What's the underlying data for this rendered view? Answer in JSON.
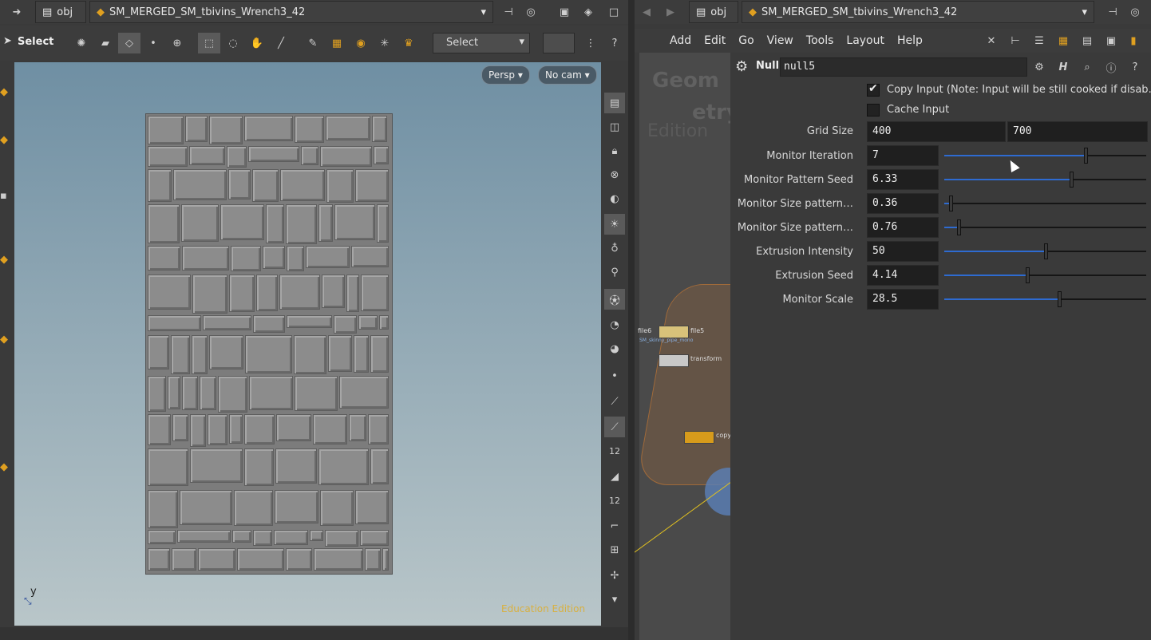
{
  "left_pane": {
    "path_root": "obj",
    "object_name": "SM_MERGED_SM_tbivins_Wrench3_42",
    "toolbar": {
      "tool_label": "Select",
      "selection_dropdown": "Select"
    },
    "viewport": {
      "persp_button": "Persp",
      "cam_button": "No cam",
      "axis_label": "y",
      "watermark": "Education Edition"
    }
  },
  "right_pane": {
    "path_root": "obj",
    "object_name": "SM_MERGED_SM_tbivins_Wrench3_42",
    "menu": [
      "Add",
      "Edit",
      "Go",
      "View",
      "Tools",
      "Layout",
      "Help"
    ],
    "network_watermark": [
      "Geom",
      "etry",
      "Edition"
    ],
    "nodes": [
      "file6",
      "file5",
      "transform",
      "copy"
    ],
    "node_subtext": "SM_skinny_pipe_mono"
  },
  "parameters": {
    "node_type": "Null",
    "node_name": "null5",
    "copy_input_label": "Copy Input (Note: Input will be still cooked if disab…",
    "copy_input_checked": true,
    "cache_input_label": "Cache Input",
    "cache_input_checked": false,
    "grid_size_label": "Grid Size",
    "grid_size": [
      "400",
      "700"
    ],
    "sliders": [
      {
        "label": "Monitor Iteration",
        "value": "7",
        "fraction": 0.7
      },
      {
        "label": "Monitor Pattern Seed",
        "value": "6.33",
        "fraction": 0.63
      },
      {
        "label": "Monitor Size pattern…",
        "value": "0.36",
        "fraction": 0.03
      },
      {
        "label": "Monitor Size pattern…",
        "value": "0.76",
        "fraction": 0.07
      },
      {
        "label": "Extrusion Intensity",
        "value": "50",
        "fraction": 0.5
      },
      {
        "label": "Extrusion Seed",
        "value": "4.14",
        "fraction": 0.41
      },
      {
        "label": "Monitor Scale",
        "value": "28.5",
        "fraction": 0.57
      }
    ]
  },
  "colors": {
    "accent": "#2e6bd1",
    "node_yellow": "#d79b1b",
    "viewport_top": "#6f8fa3",
    "viewport_bottom": "#b9c6c9"
  }
}
